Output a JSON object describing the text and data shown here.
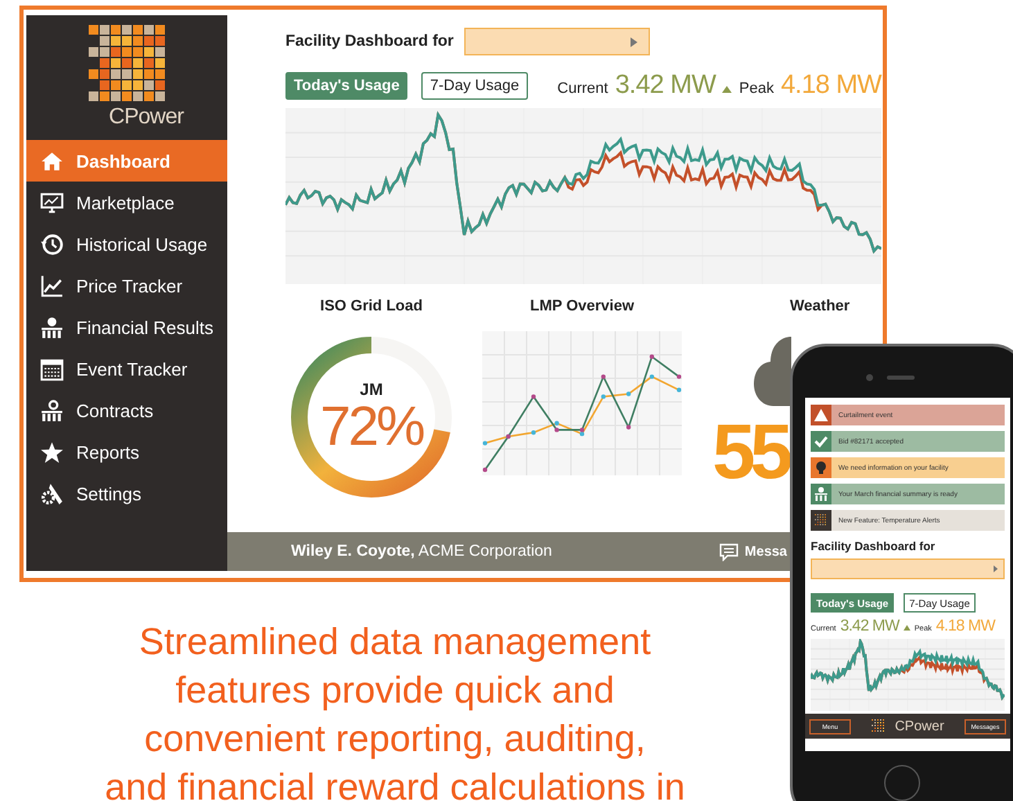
{
  "desktop": {
    "logo": {
      "text": "CPower"
    },
    "sidebar": {
      "items": [
        {
          "label": "Dashboard",
          "selected": true
        },
        {
          "label": "Marketplace",
          "selected": false
        },
        {
          "label": "Historical Usage",
          "selected": false
        },
        {
          "label": "Price Tracker",
          "selected": false
        },
        {
          "label": "Financial Results",
          "selected": false
        },
        {
          "label": "Event Tracker",
          "selected": false
        },
        {
          "label": "Contracts",
          "selected": false
        },
        {
          "label": "Reports",
          "selected": false
        },
        {
          "label": "Settings",
          "selected": false
        }
      ]
    },
    "facility_label": "Facility Dashboard for",
    "usage_tabs": [
      {
        "label": "Today's Usage",
        "selected": true
      },
      {
        "label": "7-Day Usage",
        "selected": false
      }
    ],
    "current_label": "Current",
    "current_value": "3.42 MW",
    "peak_label": "Peak",
    "peak_value": "4.18 MW",
    "panels": [
      {
        "kind": "gauge",
        "title": "ISO Grid Load",
        "label": "JM",
        "value": "72%",
        "level": 0.72
      },
      {
        "kind": "lines",
        "title": "LMP Overview"
      },
      {
        "kind": "weather",
        "title": "Weather",
        "value": "55"
      }
    ],
    "footer": {
      "user": "**Wiley E. Coyote,** ACME Corporation",
      "messages_label": "Messa"
    }
  },
  "phone": {
    "notifications": [
      {
        "text": "Curtailment event",
        "color": "#dba497"
      },
      {
        "text": "Bid #82171 accepted",
        "color": "#9dbba2"
      },
      {
        "text": "We need information on your facility",
        "color": "#f8cf90"
      },
      {
        "text": "Your March financial summary is ready",
        "color": "#9dbba2"
      },
      {
        "text": "New Feature: Temperature Alerts",
        "color": "#e6e1da"
      }
    ],
    "facility_label": "Facility Dashboard for",
    "usage_tabs": [
      {
        "label": "Today's Usage",
        "selected": true
      },
      {
        "label": "7-Day Usage",
        "selected": false
      }
    ],
    "current_label": "Current",
    "current_value": "3.42 MW",
    "peak_label": "Peak",
    "peak_value": "4.18 MW",
    "menu_label": "Menu",
    "logo_text": "CPower",
    "messages_label": "Messages"
  },
  "caption_lines": [
    "Streamlined data management",
    "features provide quick and",
    "convenient reporting, auditing,",
    "and financial reward calculations in"
  ]
}
